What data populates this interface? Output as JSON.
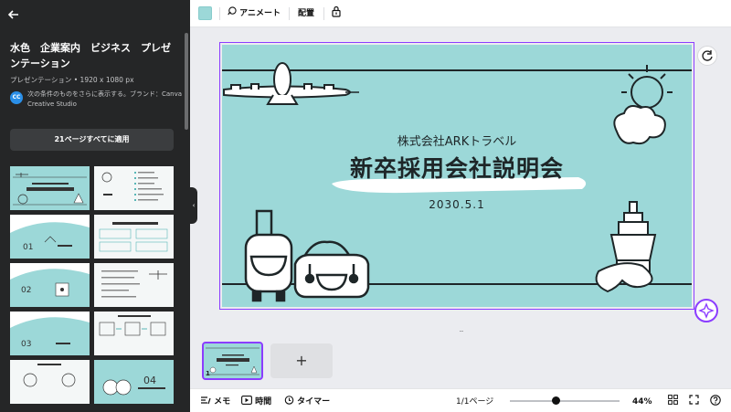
{
  "colors": {
    "accent": "#8b3dff",
    "slide_bg": "#9cd8d8",
    "sidebar_bg": "#252627",
    "ink": "#1e2628"
  },
  "sidebar": {
    "back_icon": "arrow-left-icon",
    "template_title": "水色　企業案内　ビジネス　プレゼンテーション",
    "template_meta": "プレゼンテーション • 1920 x 1080 px",
    "brand_avatar": "CC",
    "brand_text": "次の条件のものをさらに表示する。ブランド：Canva Creative Studio",
    "apply_all_button": "21ページすべてに適用",
    "thumbnails": [
      {
        "label": "新卒採用会社説明会"
      },
      {
        "label": "目次"
      },
      {
        "label": "01 企業理念"
      },
      {
        "label": "弊社の強み"
      },
      {
        "label": "02 会社概要"
      },
      {
        "label": "会社概要"
      },
      {
        "label": "03 事業内容"
      },
      {
        "label": "事業内容"
      },
      {
        "label": "社員紹介"
      },
      {
        "label": "04 仕事紹介"
      }
    ]
  },
  "toolbar": {
    "animate_label": "アニメート",
    "arrange_label": "配置",
    "lock_icon": "lock-icon"
  },
  "slide": {
    "company": "株式会社ARKトラベル",
    "title": "新卒採用会社説明会",
    "date": "2030.5.1"
  },
  "pages": {
    "current_page_number": "1",
    "add_page_icon": "plus-icon"
  },
  "footer": {
    "notes_label": "メモ",
    "time_label": "時間",
    "timer_label": "タイマー",
    "page_indicator": "1/1ページ",
    "zoom_value": "44%",
    "zoom_level": 0.44
  }
}
